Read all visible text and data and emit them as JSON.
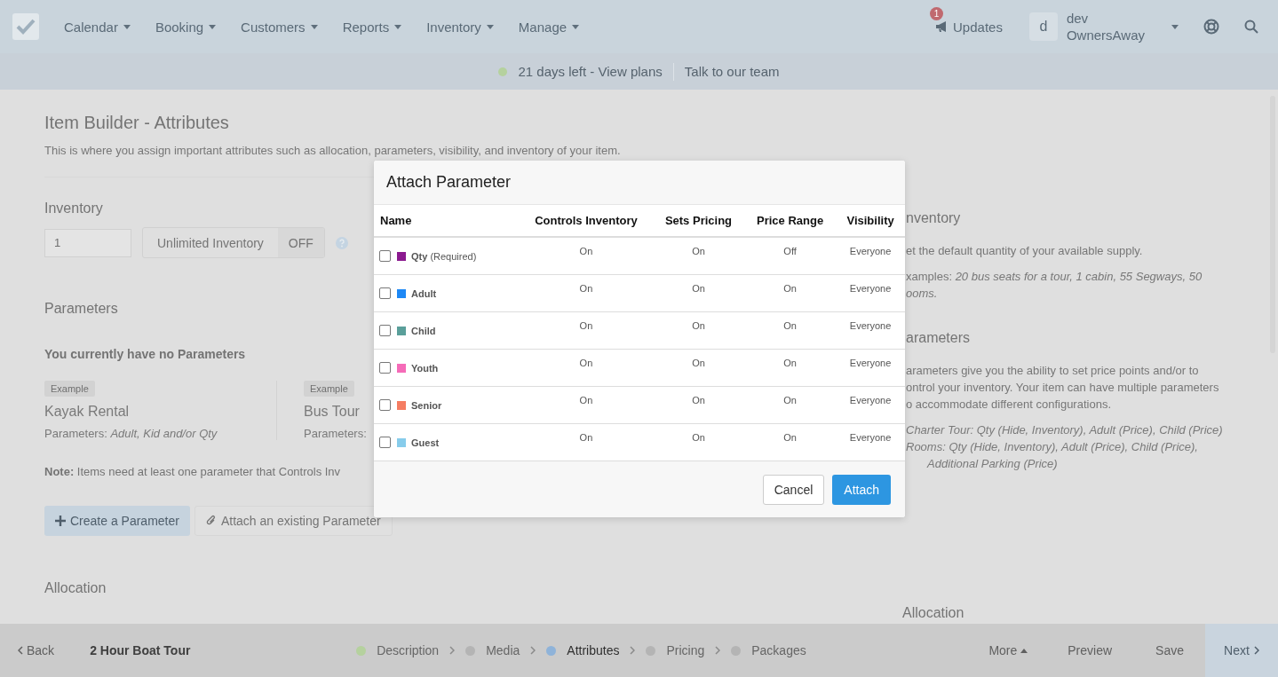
{
  "nav": {
    "items": [
      "Calendar",
      "Booking",
      "Customers",
      "Reports",
      "Inventory",
      "Manage"
    ],
    "updates": {
      "label": "Updates",
      "badge": "1"
    },
    "user": {
      "avatar": "d",
      "name": "dev",
      "company": "OwnersAway"
    }
  },
  "trial_bar": {
    "status": "21 days left - View plans",
    "link": "Talk to our team"
  },
  "page": {
    "title": "Item Builder - Attributes",
    "subtitle": "This is where you assign important attributes such as allocation, parameters, visibility, and inventory of your item.",
    "inventory": {
      "heading": "Inventory",
      "quantity": "1",
      "toggle": {
        "label": "Unlimited Inventory",
        "state_label": "OFF",
        "on": false
      }
    },
    "parameters": {
      "heading": "Parameters",
      "empty": "You currently have no Parameters",
      "examples": [
        {
          "badge": "Example",
          "title": "Kayak Rental",
          "text": "Parameters: *Adult, Kid and/or Qty*"
        },
        {
          "badge": "Example",
          "title": "Bus Tour",
          "text": "Parameters:"
        }
      ],
      "note": "**Note:** Items need at least one parameter that Controls Inv",
      "buttons": [
        "Create a Parameter",
        "Attach an existing Parameter"
      ]
    },
    "allocation": "Allocation"
  },
  "help": {
    "inventory_heading": "nventory",
    "inventory_lines": [
      "et the default quantity of your available supply."
    ],
    "examples_lines": [
      "xamples: *20 bus seats for a tour, 1 cabin, 55 Segways, 50*",
      "*ooms.*"
    ],
    "parameters_heading": "arameters",
    "parameters_lines": [
      "arameters give you the ability to set price points and/or to",
      "ontrol your inventory. Your item can have multiple parameters",
      "o accommodate different configurations."
    ],
    "example_list": [
      "Charter Tour: Qty (Hide, Inventory), Adult (Price), Child (Price)",
      "Rooms: Qty (Hide, Inventory), Adult (Price), Child (Price),",
      "Additional Parking (Price)"
    ],
    "allocation": "Allocation"
  },
  "modal": {
    "title": "Attach Parameter",
    "columns": [
      "Name",
      "Controls Inventory",
      "Sets Pricing",
      "Price Range",
      "Visibility"
    ],
    "rows": [
      {
        "checked": false,
        "color": "#8b1a8f",
        "cells": [
          "**Qty** (Required)",
          "On",
          "On",
          "Off",
          "Everyone"
        ]
      },
      {
        "checked": false,
        "color": "#1e88f5",
        "cells": [
          "**Adult**",
          "On",
          "On",
          "On",
          "Everyone"
        ]
      },
      {
        "checked": false,
        "color": "#5a9f9a",
        "cells": [
          "**Child**",
          "On",
          "On",
          "On",
          "Everyone"
        ]
      },
      {
        "checked": false,
        "color": "#f56bb8",
        "cells": [
          "**Youth**",
          "On",
          "On",
          "On",
          "Everyone"
        ]
      },
      {
        "checked": false,
        "color": "#f57d62",
        "cells": [
          "**Senior**",
          "On",
          "On",
          "On",
          "Everyone"
        ]
      },
      {
        "checked": false,
        "color": "#87cceb",
        "cells": [
          "**Guest**",
          "On",
          "On",
          "On",
          "Everyone"
        ]
      }
    ],
    "cancel": "Cancel",
    "confirm": "Attach"
  },
  "footer": {
    "back": "Back",
    "item": "2 Hour Boat Tour",
    "steps": [
      {
        "label": "Description",
        "color": "#b5d19e",
        "selected": false
      },
      {
        "label": "Media",
        "color": "#b4b4b4",
        "selected": false
      },
      {
        "label": "Attributes",
        "color": "#8fb3d9",
        "selected": true
      },
      {
        "label": "Pricing",
        "color": "#b4b4b4",
        "selected": false
      },
      {
        "label": "Packages",
        "color": "#b4b4b4",
        "selected": false
      }
    ],
    "more": "More",
    "preview": "Preview",
    "save": "Save",
    "next": "Next"
  }
}
